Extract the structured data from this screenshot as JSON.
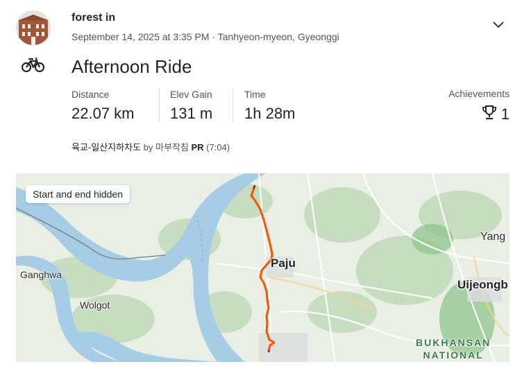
{
  "activity": {
    "athlete_name": "forest in",
    "datetime_location": "September 14, 2025 at 3:35 PM · Tanhyeon-myeon, Gyeonggi",
    "sport_icon": "bike-icon",
    "title": "Afternoon Ride"
  },
  "stats": {
    "distance": {
      "label": "Distance",
      "value": "22.07 km"
    },
    "elev_gain": {
      "label": "Elev Gain",
      "value": "131 m"
    },
    "time": {
      "label": "Time",
      "value": "1h 28m"
    },
    "achievements": {
      "label": "Achievements",
      "value": "1",
      "icon": "trophy-icon"
    }
  },
  "segment": {
    "name": "육교-일산지하차도",
    "by_label": "by",
    "owner": "마부작침",
    "pr_label": "PR",
    "pr_time": "(7:04)"
  },
  "map": {
    "privacy_label": "Start and end hidden",
    "places": {
      "paju": "Paju",
      "ganghwa": "Ganghwa",
      "wolgot": "Wolgot",
      "yang": "Yang",
      "uijeongbu": "Uijeongb",
      "park_line1": "BUKHANSAN",
      "park_line2": "NATIONAL"
    },
    "colors": {
      "route": "#fc5200",
      "water": "#a7cde6",
      "land": "#e8efe4",
      "forest": "#b8d8b0"
    }
  }
}
